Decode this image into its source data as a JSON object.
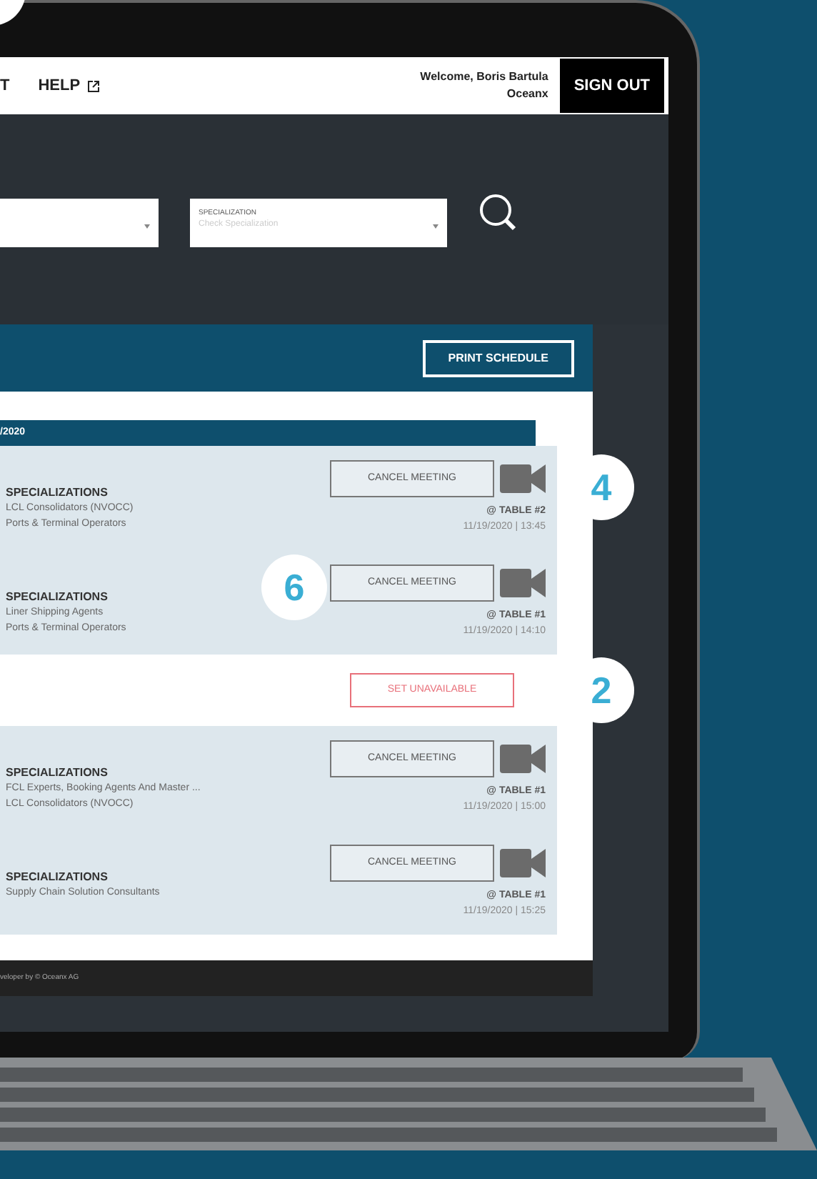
{
  "header": {
    "nav": [
      {
        "label": "T",
        "external": false
      },
      {
        "label": "HELP",
        "external": true
      }
    ],
    "welcome": "Welcome, Boris Bartula",
    "company": "Oceanx",
    "sign_out": "SIGN OUT"
  },
  "filters": [
    {
      "label": "SPECIALIZATION",
      "placeholder": "Check Specialization"
    }
  ],
  "schedule": {
    "print_button": "PRINT SCHEDULE",
    "date": "/2020",
    "slots": [
      {
        "kind": "meeting",
        "heading": "SPECIALIZATIONS",
        "specializations": [
          "LCL Consolidators (NVOCC)",
          "Ports & Terminal Operators"
        ],
        "button": "CANCEL MEETING",
        "table": "@ TABLE #2",
        "time": "11/19/2020 | 13:45"
      },
      {
        "kind": "meeting",
        "heading": "SPECIALIZATIONS",
        "specializations": [
          "Liner Shipping Agents",
          "Ports & Terminal Operators"
        ],
        "button": "CANCEL MEETING",
        "table": "@ TABLE #1",
        "time": "11/19/2020 | 14:10"
      },
      {
        "kind": "free",
        "button": "SET UNAVAILABLE"
      },
      {
        "kind": "meeting",
        "heading": "SPECIALIZATIONS",
        "specializations": [
          "FCL Experts, Booking Agents And Master ...",
          "LCL Consolidators (NVOCC)"
        ],
        "button": "CANCEL MEETING",
        "table": "@ TABLE #1",
        "time": "11/19/2020 | 15:00"
      },
      {
        "kind": "meeting",
        "heading": "SPECIALIZATIONS",
        "specializations": [
          "Supply Chain Solution Consultants"
        ],
        "button": "CANCEL MEETING",
        "table": "@ TABLE #1",
        "time": "11/19/2020 | 15:25"
      }
    ],
    "footer": "veloper by © Oceanx AG"
  },
  "callouts": [
    {
      "number": "4"
    },
    {
      "number": "6"
    },
    {
      "number": "2"
    }
  ]
}
